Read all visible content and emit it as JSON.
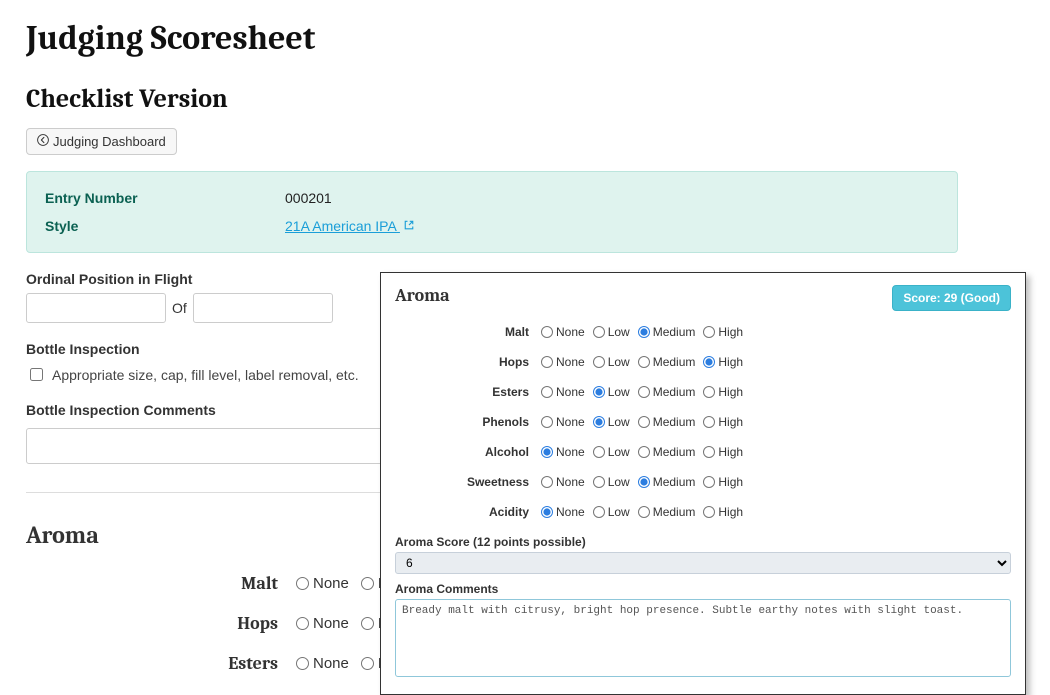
{
  "page_title": "Judging Scoresheet",
  "section_title": "Checklist Version",
  "back_button_label": "Judging Dashboard",
  "entry": {
    "entry_number_label": "Entry Number",
    "entry_number_value": "000201",
    "style_label": "Style",
    "style_value": "21A American IPA"
  },
  "flight": {
    "label": "Ordinal Position in Flight",
    "of_label": "Of",
    "pos_value": "",
    "total_value": ""
  },
  "bottle": {
    "inspection_label": "Bottle Inspection",
    "checkbox_label": "Appropriate size, cap, fill level, label removal, etc.",
    "comments_label": "Bottle Inspection Comments",
    "comments_value": ""
  },
  "radio_levels": [
    "None",
    "Low",
    "Medium",
    "High"
  ],
  "bg_aroma": {
    "title": "Aroma",
    "rows": [
      {
        "name": "Malt",
        "selected": ""
      },
      {
        "name": "Hops",
        "selected": ""
      },
      {
        "name": "Esters",
        "selected": ""
      }
    ]
  },
  "panel": {
    "title": "Aroma",
    "score_badge": "Score: 29 (Good)",
    "rows": [
      {
        "name": "Malt",
        "selected": "Medium"
      },
      {
        "name": "Hops",
        "selected": "High"
      },
      {
        "name": "Esters",
        "selected": "Low"
      },
      {
        "name": "Phenols",
        "selected": "Low"
      },
      {
        "name": "Alcohol",
        "selected": "None"
      },
      {
        "name": "Sweetness",
        "selected": "Medium"
      },
      {
        "name": "Acidity",
        "selected": "None"
      }
    ],
    "score_label": "Aroma Score (12 points possible)",
    "score_value": "6",
    "comments_label": "Aroma Comments",
    "comments_value": "Bready malt with citrusy, bright hop presence. Subtle earthy notes with slight toast."
  }
}
